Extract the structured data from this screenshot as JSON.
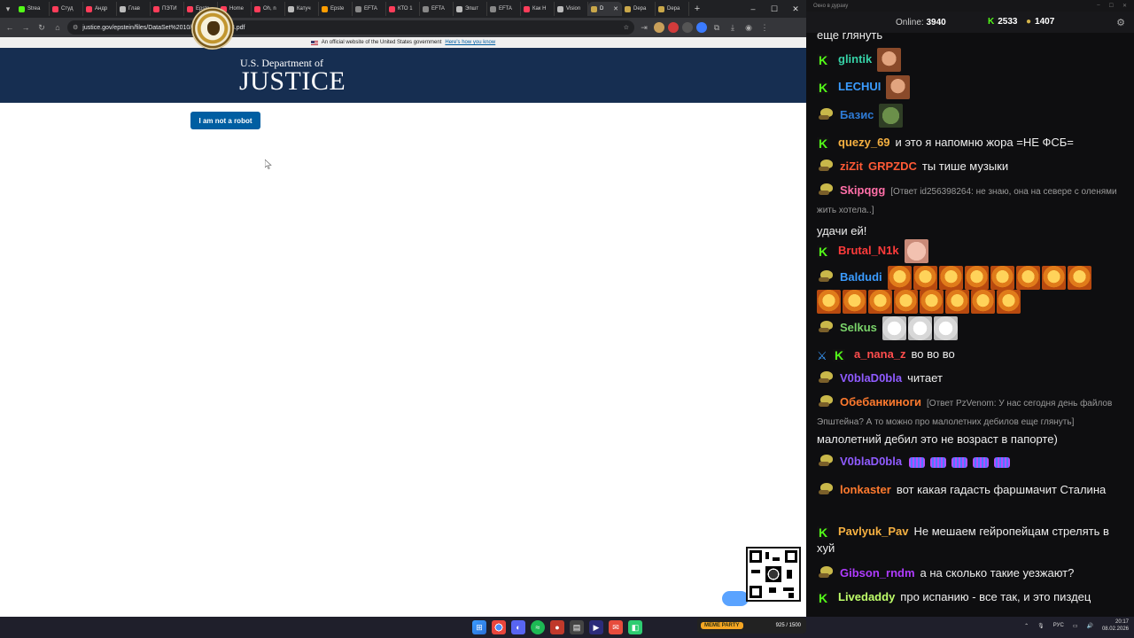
{
  "browser": {
    "tabs": [
      {
        "label": "Strea",
        "color": "#53fc18"
      },
      {
        "label": "Студ",
        "color": "#ff3d5a"
      },
      {
        "label": "Андр",
        "color": "#ff3d5a"
      },
      {
        "label": "Глав",
        "color": "#bbbbbb"
      },
      {
        "label": "ПЭТИ",
        "color": "#ff3d5a"
      },
      {
        "label": "Epste",
        "color": "#ff3d5a"
      },
      {
        "label": "Home",
        "color": "#ff3d5a"
      },
      {
        "label": "Oh, n",
        "color": "#ff3d5a"
      },
      {
        "label": "Катуч",
        "color": "#bbbbbb"
      },
      {
        "label": "Epste",
        "color": "#ff9d00"
      },
      {
        "label": "EFTA",
        "color": "#888888"
      },
      {
        "label": "КТО 1",
        "color": "#ff3d5a"
      },
      {
        "label": "EFTA",
        "color": "#888888"
      },
      {
        "label": "Эпшт",
        "color": "#bbbbbb"
      },
      {
        "label": "EFTA",
        "color": "#888888"
      },
      {
        "label": "Как Н",
        "color": "#ff3d5a"
      },
      {
        "label": "Vision",
        "color": "#bbbbbb"
      },
      {
        "label": "D",
        "color": "#c9a74a"
      },
      {
        "label": "Depa",
        "color": "#c9a74a"
      },
      {
        "label": "Depa",
        "color": "#c9a74a"
      }
    ],
    "new_tab": "+",
    "url": "justice.gov/epstein/files/DataSet%2010/EFTA01890178.pdf",
    "gov_banner_text": "An official website of the United States government",
    "gov_banner_link": "Here's how you know",
    "dept_subtitle": "U.S. Department of",
    "dept_title": "JUSTICE",
    "robot_button": "I am not a robot"
  },
  "chat": {
    "window_title": "Окно в дураку",
    "online_label": "Online:",
    "online_count": "3940",
    "stat_green": "2533",
    "stat_gold": "1407",
    "messages": [
      {
        "user": "",
        "text": "еще глянуть"
      },
      {
        "user": "glintik",
        "color": "#36d1a6",
        "text": ""
      },
      {
        "user": "LECHUI",
        "color": "#3b9cff",
        "text": ""
      },
      {
        "user": "Базис",
        "color": "#2e7bd6",
        "text": ""
      },
      {
        "user": "quezy_69",
        "color": "#f5b041",
        "text": "и это я напомню жора =НЕ ФСБ="
      },
      {
        "user": "ziZit",
        "color": "#ff5a36",
        "user2": "GRPZDC",
        "text": "ты тише музыки"
      },
      {
        "user": "Skipqgg",
        "color": "#ff6fa8",
        "reply": "[Ответ id256398264: не знаю, она на севере с оленями жить хотела..]",
        "text": "удачи ей!"
      },
      {
        "user": "Brutal_N1k",
        "color": "#ff3b3b",
        "text": ""
      },
      {
        "user": "Baldudi",
        "color": "#3b9cff",
        "text": ""
      },
      {
        "user": "Selkus",
        "color": "#7ad36a",
        "text": ""
      },
      {
        "user": "a_nana_z",
        "color": "#ff4d4d",
        "text": "во во во"
      },
      {
        "user": "V0blaD0bla",
        "color": "#8f5bff",
        "text": "читает"
      },
      {
        "user": "Обебанкиноги",
        "color": "#ff7a2e",
        "reply": "[Ответ PzVenom: У нас сегодня день файлов Эпштейна? А то можно про малолетних дебилов еще глянуть]",
        "text": "малолетний дебил это не возраст в папорте)"
      },
      {
        "user": "V0blaD0bla",
        "color": "#8f5bff",
        "text": ""
      },
      {
        "user": "lonkaster",
        "color": "#ff7a2e",
        "text": "вот какая гадасть фаршмачит Сталина"
      },
      {
        "user": "Pavlyuk_Pav",
        "color": "#f5b041",
        "text": "Не мешаем гейропейцам стрелять в хуй"
      },
      {
        "user": "Gibson_rndm",
        "color": "#b03bff",
        "text": "а на сколько такие уезжают?"
      },
      {
        "user": "Livedaddy",
        "color": "#bfff6a",
        "text": "про испанию - все так, и это пиздец"
      }
    ]
  },
  "taskbar": {
    "widget_label": "MEME PARTY",
    "widget_count": "925 / 1500",
    "lang": "РУС",
    "time": "20:17",
    "date": "08.02.2026"
  }
}
